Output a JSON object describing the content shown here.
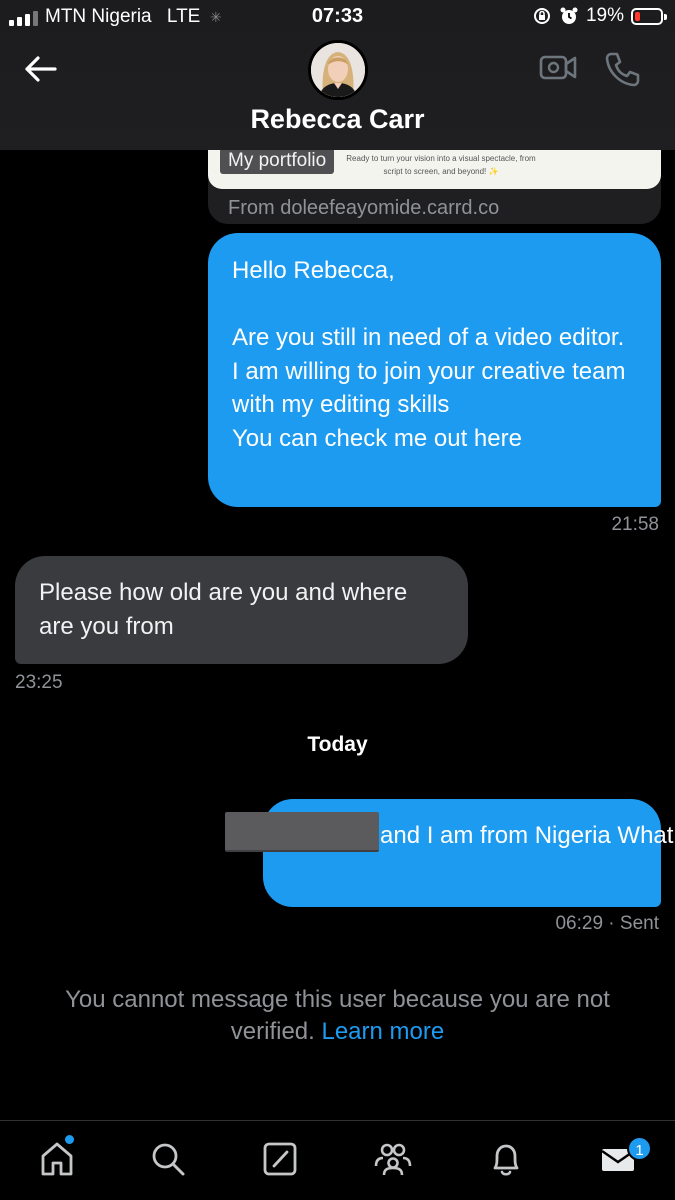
{
  "status_bar": {
    "carrier": "MTN Nigeria",
    "network": "LTE",
    "time": "07:33",
    "battery_percent": "19%",
    "battery_level": 0.19
  },
  "header": {
    "back_icon": "arrow-left-icon",
    "contact_name": "Rebecca Carr",
    "video_icon": "video-camera-icon",
    "call_icon": "phone-icon"
  },
  "link_card": {
    "chip_label": "My portfolio",
    "blurb": "Ready to turn your vision into a visual spectacle, from script to screen, and beyond! ✨",
    "source": "From doleefeayomide.carrd.co"
  },
  "messages": [
    {
      "direction": "sent",
      "text": "Hello Rebecca,\n\nAre you still in need of a video editor. I am willing to join your creative team with my editing skills\nYou can check me out here",
      "time": "21:58"
    },
    {
      "direction": "received",
      "text": "Please how old are you and where are you from",
      "time": "23:25"
    },
    {
      "direction": "sent",
      "text": "and I am from Nigeria\nWhat about you ?",
      "time": "06:29",
      "status": "· Sent"
    }
  ],
  "day_separator": "Today",
  "notice": {
    "text": "You cannot message this user because you are not verified.",
    "link": "Learn more"
  },
  "bottom_nav": {
    "items": [
      "home-icon",
      "search-icon",
      "compose-icon",
      "communities-icon",
      "notifications-icon",
      "messages-icon"
    ],
    "messages_badge": "1"
  },
  "colors": {
    "accent": "#1d9bf0",
    "sent_bubble": "#1d9bf0",
    "received_bubble": "#3a3b3f",
    "background": "#000000"
  }
}
